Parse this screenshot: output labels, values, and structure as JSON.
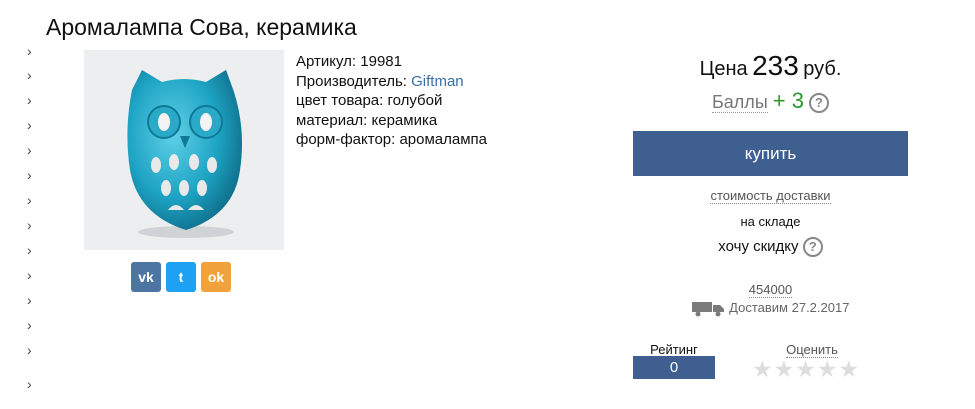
{
  "product": {
    "title": "Аромалампа Сова, керамика",
    "sku_label": "Артикул: 19981",
    "manufacturer_label": "Производитель:",
    "manufacturer_name": "Giftman",
    "color_label": "цвет товара: голубой",
    "material_label": "материал: керамика",
    "form_factor_label": "форм-фактор: аромалампа"
  },
  "purchase": {
    "price_label": "Цена",
    "price_value": "233",
    "price_currency": "руб.",
    "points_label": "Баллы",
    "points_value": "+ 3",
    "help_glyph": "?",
    "buy_label": "купить",
    "delivery_cost_label": "стоимость доставки",
    "stock_label": "на складе",
    "want_discount_label": "хочу скидку",
    "postcode": "454000",
    "delivery_date_label": "Доставим 27.2.2017"
  },
  "rating": {
    "rating_label": "Рейтинг",
    "rating_value": "0",
    "rate_label": "Оценить",
    "stars_glyphs": "★★★★★"
  },
  "social": {
    "vk_glyph": "vk",
    "twitter_glyph": "t",
    "ok_glyph": "ok",
    "vk_color": "#4c75a3",
    "twitter_color": "#1da1f2",
    "ok_color": "#f2a23c"
  },
  "sidebar": {
    "chevron_glyph": "›"
  },
  "colors": {
    "accent": "#3f5f91",
    "link": "#3a6ea5",
    "points": "#2a9a2a"
  }
}
